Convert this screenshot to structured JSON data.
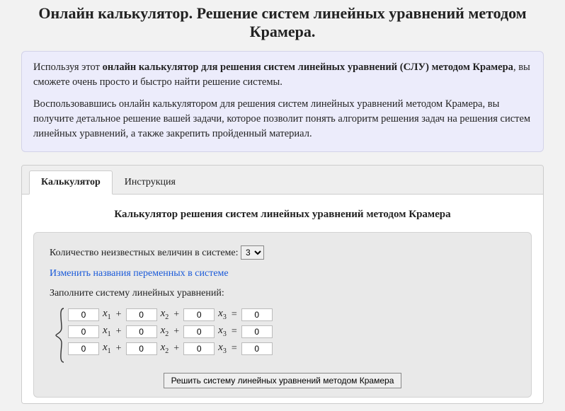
{
  "title": "Онлайн калькулятор. Решение систем линейных уравнений методом Крамера.",
  "intro": {
    "p1_prefix": "Используя этот ",
    "p1_bold": "онлайн калькулятор для решения систем линейных уравнений (СЛУ) методом Крамера",
    "p1_suffix": ", вы сможете очень просто и быстро найти решение системы.",
    "p2": "Воспользовавшись онлайн калькулятором для решения систем линейных уравнений методом Крамера, вы получите детальное решение вашей задачи, которое позволит понять алгоритм решения задач на решения систем линейных уравнений, а также закрепить пройденный материал."
  },
  "tabs": {
    "calculator": "Калькулятор",
    "instructions": "Инструкция"
  },
  "content_title": "Калькулятор решения систем линейных уравнений методом Крамера",
  "unknowns_label": "Количество неизвестных величин в системе:",
  "unknowns_value": "3",
  "rename_link": "Изменить названия переменных в системе",
  "fill_label": "Заполните систему линейных уравнений:",
  "var": {
    "name": "x",
    "s1": "1",
    "s2": "2",
    "s3": "3"
  },
  "op": {
    "plus": "+",
    "eq": "="
  },
  "rows": [
    {
      "c1": "0",
      "c2": "0",
      "c3": "0",
      "rhs": "0"
    },
    {
      "c1": "0",
      "c2": "0",
      "c3": "0",
      "rhs": "0"
    },
    {
      "c1": "0",
      "c2": "0",
      "c3": "0",
      "rhs": "0"
    }
  ],
  "solve_button": "Решить систему линейных уравнений методом Крамера"
}
